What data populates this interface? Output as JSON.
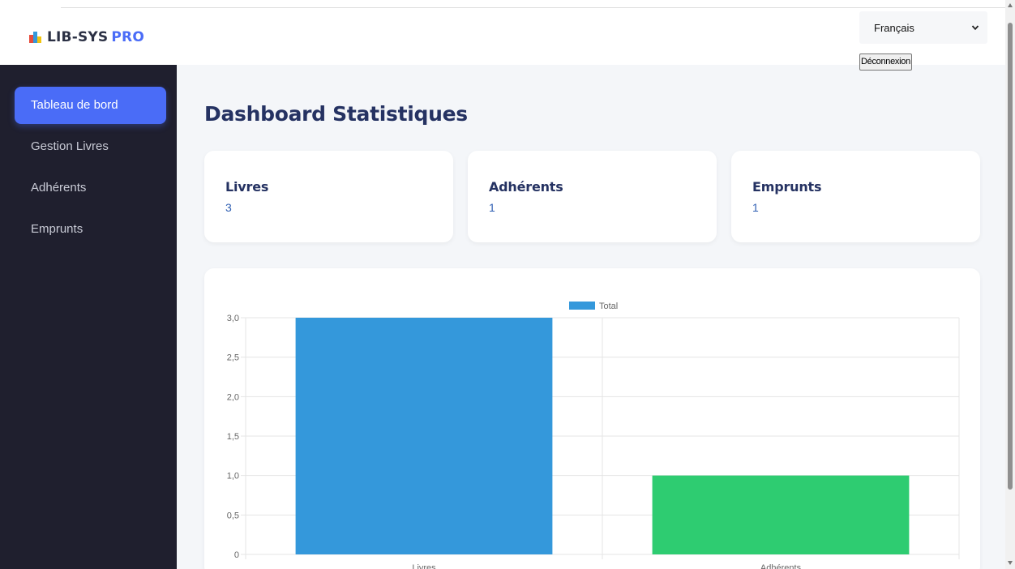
{
  "app": {
    "logo_name": "LIB-SYS",
    "logo_accent": "PRO",
    "logo_icon": "books-icon",
    "brand_color": "#4a6cf7"
  },
  "header": {
    "language_select": {
      "value": "Français",
      "icon": "chevron-down-icon"
    },
    "logout_label": "Déconnexion"
  },
  "sidebar": {
    "items": [
      {
        "label": "Tableau de bord",
        "active": true
      },
      {
        "label": "Gestion Livres",
        "active": false
      },
      {
        "label": "Adhérents",
        "active": false
      },
      {
        "label": "Emprunts",
        "active": false
      }
    ]
  },
  "main": {
    "title": "Dashboard Statistiques",
    "stats": [
      {
        "label": "Livres",
        "value": "3"
      },
      {
        "label": "Adhérents",
        "value": "1"
      },
      {
        "label": "Emprunts",
        "value": "1"
      }
    ]
  },
  "chart_data": {
    "type": "bar",
    "categories": [
      "Livres",
      "Adhérents"
    ],
    "series": [
      {
        "name": "Total",
        "values": [
          3,
          1
        ],
        "colors": [
          "#3498db",
          "#2ecc71"
        ]
      }
    ],
    "ylim": [
      0,
      3
    ],
    "yticks": [
      "0",
      "0,5",
      "1,0",
      "1,5",
      "2,0",
      "2,5",
      "3,0"
    ],
    "grid": true,
    "legend": "top-center"
  }
}
